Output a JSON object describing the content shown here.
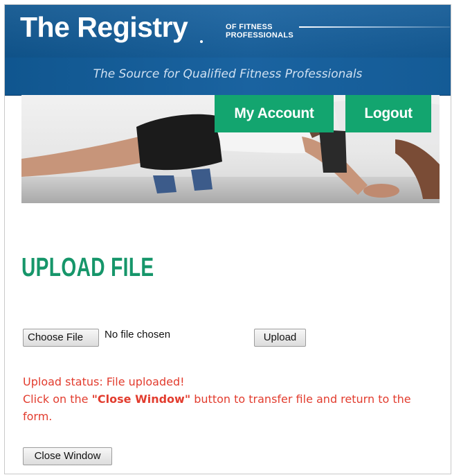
{
  "header": {
    "logo_main": "The Registry",
    "logo_sub_line1": "OF FITNESS",
    "logo_sub_line2": "PROFESSIONALS",
    "tagline": "The Source for Qualified Fitness Professionals"
  },
  "nav": {
    "my_account": "My Account",
    "logout": "Logout"
  },
  "page": {
    "title": "UPLOAD FILE"
  },
  "upload": {
    "choose_label": "Choose File",
    "file_status": "No file chosen",
    "upload_label": "Upload",
    "status_line": "Upload status: File uploaded!",
    "instruction_pre": "Click on the ",
    "instruction_emphasis": "\"Close Window\"",
    "instruction_post": " button to transfer file and return to the form.",
    "close_label": "Close Window"
  },
  "colors": {
    "header_blue": "#145b96",
    "accent_green": "#13a56f",
    "title_green": "#16966a",
    "status_red": "#e23c2e"
  }
}
